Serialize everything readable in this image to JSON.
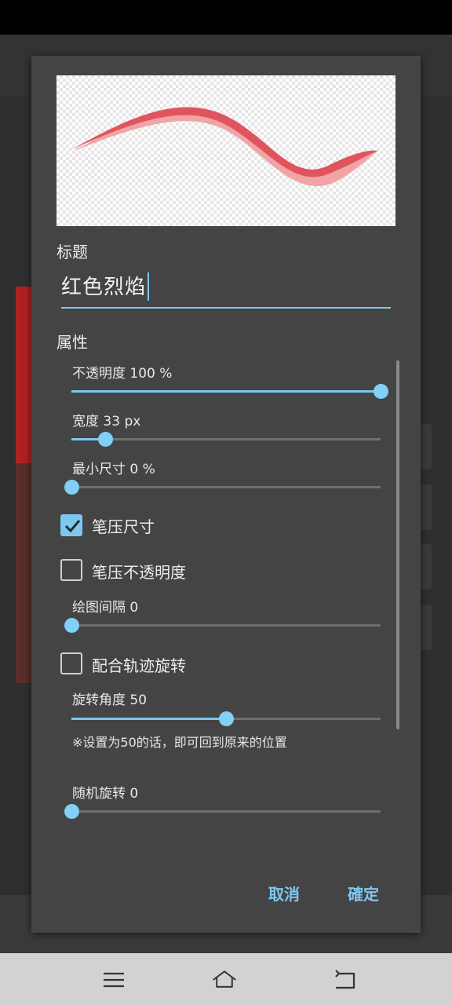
{
  "dialog": {
    "title_label": "标题",
    "title_value": "红色烈焰",
    "properties_label": "属性",
    "sliders": [
      {
        "label": "不透明度 100 %",
        "level": 1.0
      },
      {
        "label": "宽度 33 px",
        "level": 0.11
      },
      {
        "label": "最小尺寸  0  %",
        "level": 0.0
      }
    ],
    "checkbox_pressure_size": {
      "label": "笔压尺寸",
      "checked": true
    },
    "checkbox_pressure_opacity": {
      "label": "笔压不透明度",
      "checked": false
    },
    "spacing_slider": {
      "label": "绘图间隔  0",
      "level": 0.0
    },
    "checkbox_follow_rotation": {
      "label": "配合轨迹旋转",
      "checked": false
    },
    "rotation_slider": {
      "label": "旋转角度 50",
      "level": 0.5
    },
    "rotation_note": "※设置为50的话，即可回到原来的位置",
    "random_rotation_slider": {
      "label": "随机旋转  0",
      "level": 0.0
    },
    "cancel_label": "取消",
    "ok_label": "確定"
  },
  "colors": {
    "accent": "#7cc8f0",
    "stroke_main": "#e0555d",
    "stroke_shadow": "#f0a4a6",
    "dialog_bg": "#444444"
  },
  "navbar": {
    "icons": [
      "menu-icon",
      "home-icon",
      "back-icon"
    ]
  }
}
